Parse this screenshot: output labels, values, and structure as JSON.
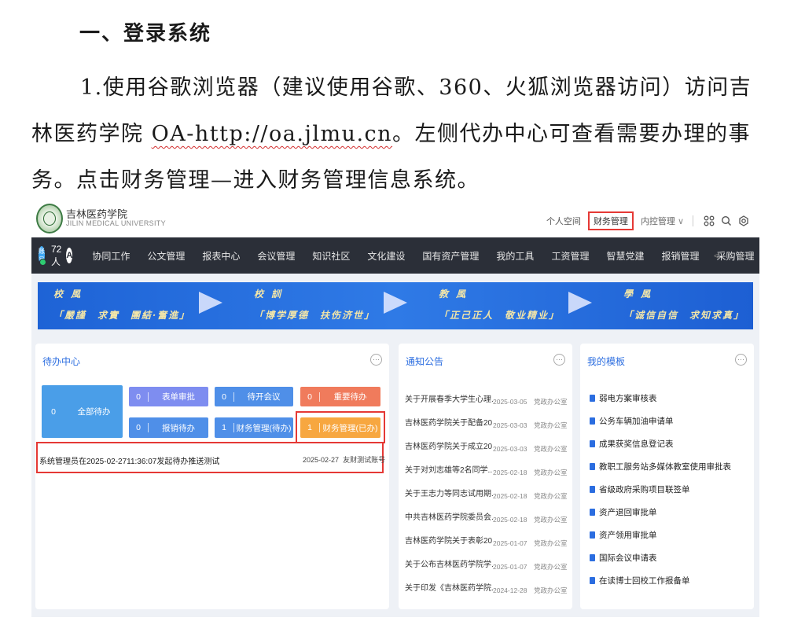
{
  "doc": {
    "heading": "一、登录系统",
    "para_prefix": "1.使用谷歌浏览器（建议使用谷歌、360、火狐浏览器访问）访问吉林医药学院 ",
    "url": "OA-http://oa.jlmu.cn",
    "para_suffix": "。左侧代办中心可查看需要办理的事务。点击财务管理—进入财务管理信息系统。"
  },
  "screenshot": {
    "brand_cn": "吉林医药学院",
    "brand_en": "JILIN MEDICAL UNIVERSITY",
    "top_links": {
      "personal": "个人空间",
      "finance": "财务管理",
      "internal": "内控管理",
      "chevron": "∨"
    },
    "icons": [
      "apps-icon",
      "search-icon",
      "settings-icon"
    ],
    "nav": {
      "avatar_text": "账号",
      "count": "72人",
      "compass": "A",
      "items": [
        "协同工作",
        "公文管理",
        "报表中心",
        "会议管理",
        "知识社区",
        "文化建设",
        "国有资产管理",
        "我的工具",
        "工资管理",
        "智慧党建",
        "报销管理",
        "采购管理"
      ],
      "arrows": "< >"
    },
    "banner": [
      {
        "title": "校 風",
        "text": "「嚴謹　求實　團結·奮進」"
      },
      {
        "title": "校 訓",
        "text": "「博学厚德　扶伤济世」"
      },
      {
        "title": "教 風",
        "text": "「正己正人　敬业精业」"
      },
      {
        "title": "學 風",
        "text": "「诚信自信　求知求真」"
      }
    ],
    "todo": {
      "title": "待办中心",
      "more": "···",
      "tiles": {
        "all": {
          "num": "0",
          "label": "全部待办"
        },
        "form": {
          "num": "0",
          "label": "表单审批"
        },
        "meeting": {
          "num": "0",
          "label": "待开会议"
        },
        "important": {
          "num": "0",
          "label": "重要待办"
        },
        "reimburse": {
          "num": "0",
          "label": "报销待办"
        },
        "finance_pending": {
          "num": "1",
          "label": "财务管理(待办)"
        },
        "finance_done": {
          "num": "1",
          "label": "财务管理(已办)"
        }
      },
      "item_text": "系统管理员在2025-02-2711:36:07发起待办推送测试",
      "item_date": "2025-02-27",
      "item_sender": "友财测试账号"
    },
    "notices": {
      "title": "通知公告",
      "more": "···",
      "rows": [
        {
          "t": "关于开展春季大学生心理...",
          "d": "2025-03-05",
          "s": "党政办公室"
        },
        {
          "t": "吉林医药学院关于配备20...",
          "d": "2025-03-03",
          "s": "党政办公室"
        },
        {
          "t": "吉林医药学院关于成立20...",
          "d": "2025-03-03",
          "s": "党政办公室"
        },
        {
          "t": "关于对刘志雄等2名同学...",
          "d": "2025-02-18",
          "s": "党政办公室"
        },
        {
          "t": "关于王志力等同志试用期...",
          "d": "2025-02-18",
          "s": "党政办公室"
        },
        {
          "t": "中共吉林医药学院委员会...",
          "d": "2025-02-18",
          "s": "党政办公室"
        },
        {
          "t": "吉林医药学院关于表彰20...",
          "d": "2025-01-07",
          "s": "党政办公室"
        },
        {
          "t": "关于公布吉林医药学院学...",
          "d": "2025-01-07",
          "s": "党政办公室"
        },
        {
          "t": "关于印发《吉林医药学院...",
          "d": "2024-12-28",
          "s": "党政办公室"
        }
      ]
    },
    "templates": {
      "title": "我的模板",
      "more": "···",
      "rows": [
        "弱电方案审核表",
        "公务车辆加油申请单",
        "成果获奖信息登记表",
        "教职工服务站多媒体教室使用审批表",
        "省级政府采购项目联签单",
        "资产退回审批单",
        "资产领用审批单",
        "国际会议申请表",
        "在读博士回校工作报备单"
      ]
    }
  }
}
